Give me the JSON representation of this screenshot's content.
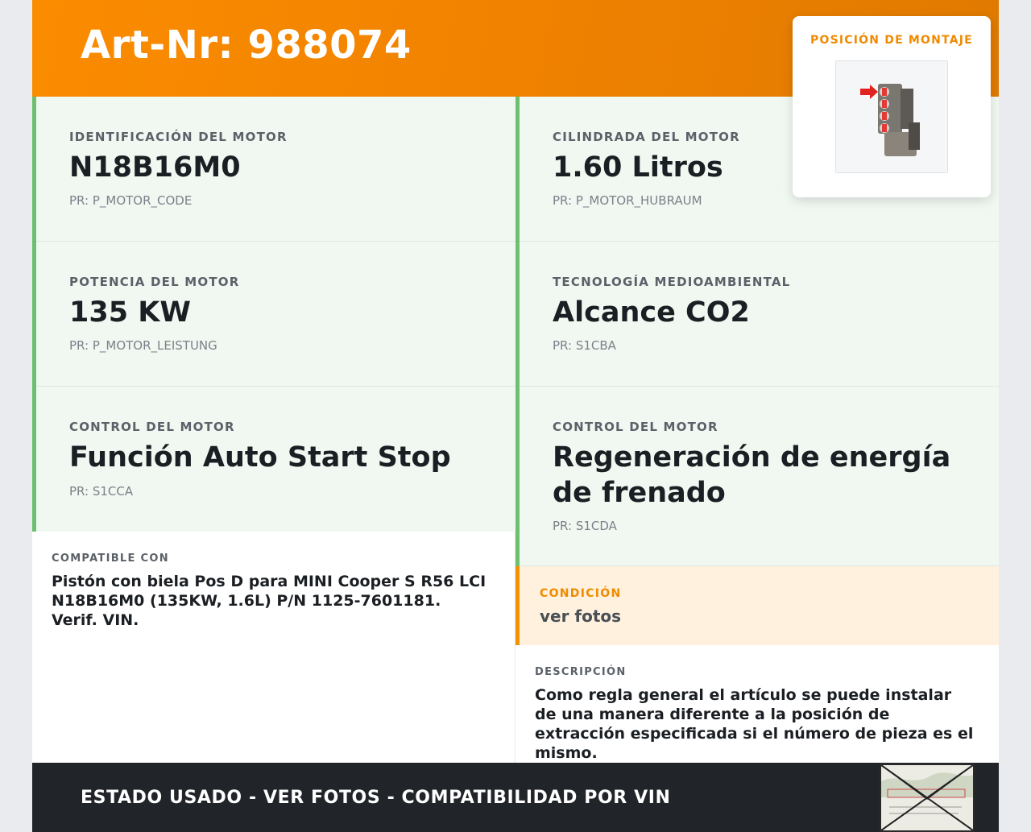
{
  "header": {
    "art_nr": "Art-Nr: 988074"
  },
  "mount_position": {
    "title": "POSICIÓN DE MONTAJE",
    "image_icon": "engine-mount-position-icon"
  },
  "specs": [
    {
      "label": "IDENTIFICACIÓN DEL MOTOR",
      "value": "N18B16M0",
      "code": "PR: P_MOTOR_CODE"
    },
    {
      "label": "CILINDRADA DEL MOTOR",
      "value": "1.60 Litros",
      "code": "PR: P_MOTOR_HUBRAUM"
    },
    {
      "label": "POTENCIA DEL MOTOR",
      "value": "135 KW",
      "code": "PR: P_MOTOR_LEISTUNG"
    },
    {
      "label": "TECNOLOGÍA MEDIOAMBIENTAL",
      "value": "Alcance CO2",
      "code": "PR: S1CBA"
    },
    {
      "label": "CONTROL DEL MOTOR",
      "value": "Función Auto Start Stop",
      "code": "PR: S1CCA"
    },
    {
      "label": "CONTROL DEL MOTOR",
      "value": "Regeneración de energía de frenado",
      "code": "PR: S1CDA"
    }
  ],
  "compatible": {
    "label": "COMPATIBLE CON",
    "text": "Pistón con biela Pos D para MINI Cooper S R56 LCI N18B16M0 (135KW, 1.6L) P/N 1125-7601181. Verif. VIN."
  },
  "condition": {
    "label": "CONDICIÓN",
    "value": "ver fotos"
  },
  "description": {
    "label": "DESCRIPCIÓN",
    "text": "Como regla general el artículo se puede instalar de una manera diferente a la posición de extracción especificada si el número de pieza es el mismo."
  },
  "footer": {
    "text": "ESTADO USADO - VER FOTOS - COMPATIBILIDAD POR VIN",
    "stamp_icon": "postal-stamp-icon"
  },
  "colors": {
    "header_orange": "#fb8c00",
    "spec_green_border": "#6cc070",
    "spec_bg": "#f1f8f2",
    "condition_bg": "#fff1de",
    "condition_accent": "#f39200",
    "footer_bg": "#212428"
  }
}
